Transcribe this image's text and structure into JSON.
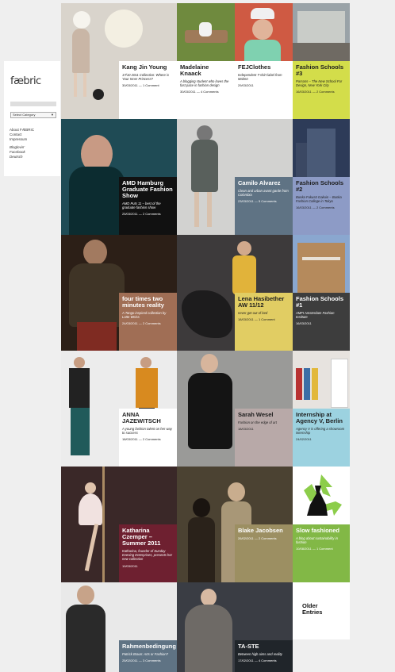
{
  "sidebar": {
    "logo": "fæbric",
    "select_label": "Select Category",
    "links": [
      "About FÆBRIC",
      "Contact",
      "Impressum"
    ],
    "social": [
      "Bloglovin'",
      "Facebook",
      "Deutsch"
    ]
  },
  "colors": {
    "page_bg": "#efefef",
    "yellow": "#e1cd63",
    "lime": "#d3dd4a",
    "slate": "#5f7384",
    "periwinkle": "#8d9bc6",
    "rust": "#a06e55",
    "sky": "#9cd2e0",
    "mauve": "#b8a9a8",
    "green": "#82b846",
    "maroon": "#6e2030",
    "olive": "#9c8f62"
  },
  "posts": [
    {
      "title": "Kang Jin Young",
      "desc": "17/10 2011 Collection: Where is Your Inner Princess?",
      "meta": "30/03/2011 — 1 Comment"
    },
    {
      "title": "Madelaine Knaack",
      "desc": "A blogging student who loves the fast pace in fashion design",
      "meta": "30/03/2011 — 4 Comments"
    },
    {
      "title": "FEJClothes",
      "desc": "Independent T-shirt label from Malmö",
      "meta": "29/03/2011"
    },
    {
      "title": "Fashion Schools #3",
      "desc": "Parsons – The New School For Design, New York City",
      "meta": "16/03/2011 — 2 Comments"
    },
    {
      "title": "AMD Hamburg Graduate Fashion Show",
      "desc": "AMD Puts 11 – best of the graduate fashion show",
      "meta": "25/03/2011 — 2 Comments"
    },
    {
      "title": "Camilo Alvarez",
      "desc": "Clean and urban avant garde from Colombia",
      "meta": "23/03/2011 — 5 Comments"
    },
    {
      "title": "Fashion Schools #2",
      "desc": "Bunka Fukusō Gakuin – Bunka Fashion College in Tokyo",
      "meta": "16/03/2011 — 2 Comments"
    },
    {
      "title": "four times two minutes reality",
      "desc": "A Tango inspired collection by Lotte Weiss",
      "meta": "24/03/2011 — 2 Comments"
    },
    {
      "title": "Lena Hasibether AW 11/12",
      "desc": "never get out of bed",
      "meta": "18/03/2011 — 1 Comment"
    },
    {
      "title": "Fashion Schools #1",
      "desc": "AMFI Amsterdam Fashion Institute",
      "meta": "16/03/2011"
    },
    {
      "title": "ANNA JAZEWITSCH",
      "desc": "A young fashion talent on her way to success",
      "meta": "18/03/2011 — 2 Comments"
    },
    {
      "title": "Sarah Wesel",
      "desc": "Fashion on the edge of art",
      "meta": "18/03/2011"
    },
    {
      "title": "Internship at Agency V, Berlin",
      "desc": "Agency V is offering a showroom internship",
      "meta": "24/02/2011"
    },
    {
      "title": "Katharina Czemper – Summer 2011",
      "desc": "Katharina, founder of Sunday Evening Enterprises, presents her new collection",
      "meta": "10/03/2011"
    },
    {
      "title": "Blake Jacobsen",
      "desc": "",
      "meta": "26/02/2011 — 2 Comments"
    },
    {
      "title": "Slow fashioned",
      "desc": "A blog about sustainability in fashion",
      "meta": "10/08/2011 — 1 Comment"
    },
    {
      "title": "Rahmenbedingung",
      "desc": "Patrick Braun: Arts or Fashion?",
      "meta": "25/02/2011 — 3 Comments"
    },
    {
      "title": "TA-STE",
      "desc": "Between high aims and reality",
      "meta": "17/02/2011 — 4 Comments"
    }
  ],
  "older_label": "Older Entries"
}
